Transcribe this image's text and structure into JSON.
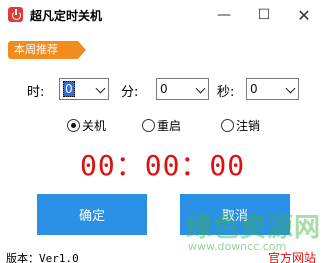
{
  "window": {
    "title": "超凡定时关机",
    "min_glyph": "—",
    "max_glyph": "☐",
    "close_glyph": "✕",
    "icon": "power-icon"
  },
  "banner": {
    "label": "本周推荐",
    "color": "#f28c1e"
  },
  "timer": {
    "hour_label": "时:",
    "hour_value": "0",
    "minute_label": "分:",
    "minute_value": "0",
    "second_label": "秒:",
    "second_value": "0"
  },
  "modes": [
    {
      "label": "关机",
      "selected": true
    },
    {
      "label": "重启",
      "selected": false
    },
    {
      "label": "注销",
      "selected": false
    }
  ],
  "countdown": {
    "text": "00：00：00",
    "color": "#e01010"
  },
  "buttons": {
    "ok_label": "确定",
    "cancel_label": "取消",
    "color": "#2b91e6"
  },
  "footer": {
    "version": "版本：Ver1.0",
    "official": "官方网站"
  },
  "watermark": {
    "text": "绿色资源网",
    "url": "www.downcc.com"
  }
}
